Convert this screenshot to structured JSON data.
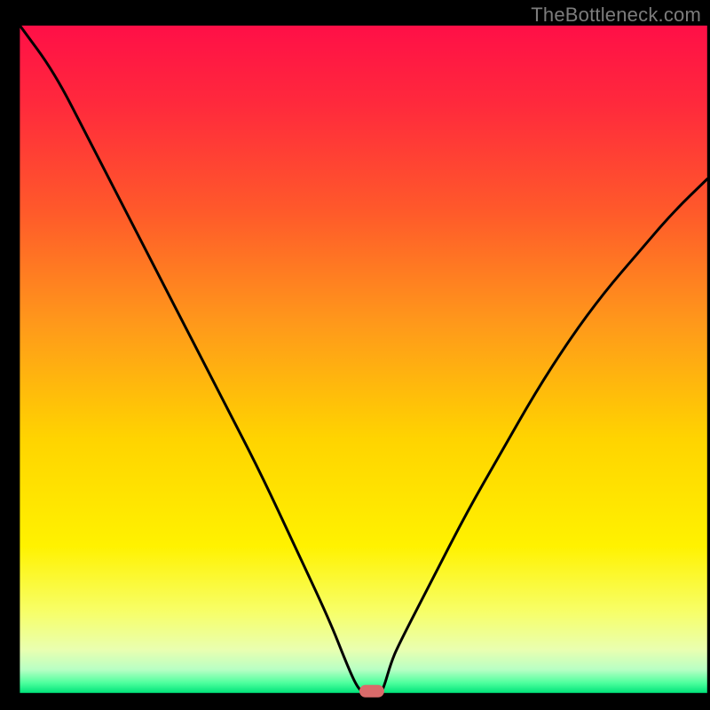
{
  "attribution": "TheBottleneck.com",
  "chart_data": {
    "type": "line",
    "title": "",
    "xlabel": "",
    "ylabel": "",
    "xlim": [
      0,
      1
    ],
    "ylim": [
      0,
      1
    ],
    "x": [
      0.0,
      0.05,
      0.1,
      0.15,
      0.2,
      0.25,
      0.3,
      0.35,
      0.4,
      0.45,
      0.475,
      0.49,
      0.5,
      0.51,
      0.525,
      0.53,
      0.54,
      0.55,
      0.6,
      0.65,
      0.7,
      0.75,
      0.8,
      0.85,
      0.9,
      0.95,
      1.0
    ],
    "values": [
      1.01,
      0.93,
      0.83,
      0.73,
      0.63,
      0.53,
      0.43,
      0.33,
      0.22,
      0.11,
      0.045,
      0.01,
      0.0,
      0.0,
      0.0,
      0.01,
      0.045,
      0.07,
      0.17,
      0.27,
      0.36,
      0.45,
      0.53,
      0.6,
      0.66,
      0.72,
      0.77
    ],
    "marker": {
      "x": 0.512,
      "y": 0.0
    },
    "gradient_stops": [
      {
        "offset": 0.0,
        "color": "#ff0f47"
      },
      {
        "offset": 0.12,
        "color": "#ff2a3c"
      },
      {
        "offset": 0.28,
        "color": "#ff5a2a"
      },
      {
        "offset": 0.45,
        "color": "#ff9a1a"
      },
      {
        "offset": 0.62,
        "color": "#ffd400"
      },
      {
        "offset": 0.78,
        "color": "#fff200"
      },
      {
        "offset": 0.88,
        "color": "#f7ff6a"
      },
      {
        "offset": 0.935,
        "color": "#e9ffb0"
      },
      {
        "offset": 0.965,
        "color": "#b8ffc4"
      },
      {
        "offset": 0.985,
        "color": "#4dff9d"
      },
      {
        "offset": 1.0,
        "color": "#00e37a"
      }
    ],
    "frame": {
      "left": 0.028,
      "right": 0.996,
      "top": 0.036,
      "bottom": 0.976
    }
  }
}
